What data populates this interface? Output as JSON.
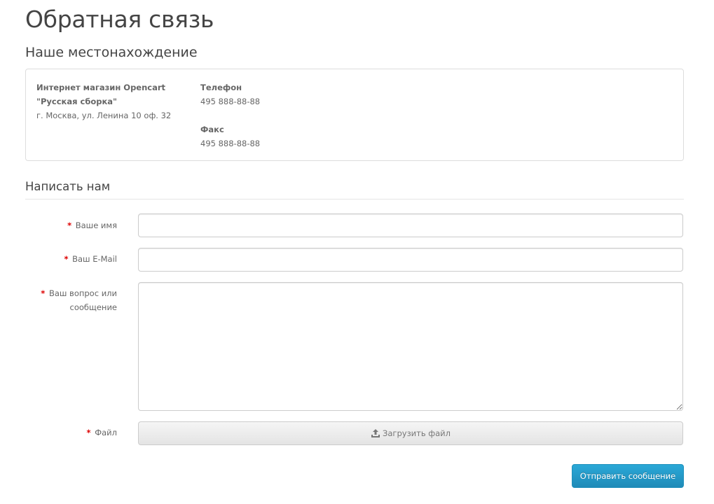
{
  "page": {
    "title": "Обратная связь"
  },
  "location": {
    "heading": "Наше местонахождение",
    "store_name_line1": "Интернет магазин Opencart",
    "store_name_line2": "\"Русская сборка\"",
    "address": "г. Москва, ул. Ленина 10 оф. 32",
    "phone_label": "Телефон",
    "phone_value": "495 888-88-88",
    "fax_label": "Факс",
    "fax_value": "495 888-88-88"
  },
  "form": {
    "heading": "Написать нам",
    "required_mark": "*",
    "name_label": "Ваше имя",
    "name_value": "",
    "email_label": "Ваш E-Mail",
    "email_value": "",
    "enquiry_label": "Ваш вопрос или сообщение",
    "enquiry_value": "",
    "file_label": "Файл",
    "upload_label": "Загрузить файл",
    "submit_label": "Отправить сообщение"
  },
  "icons": {
    "upload": "upload-icon"
  },
  "colors": {
    "accent": "#229ac8",
    "required": "#dd0000"
  }
}
